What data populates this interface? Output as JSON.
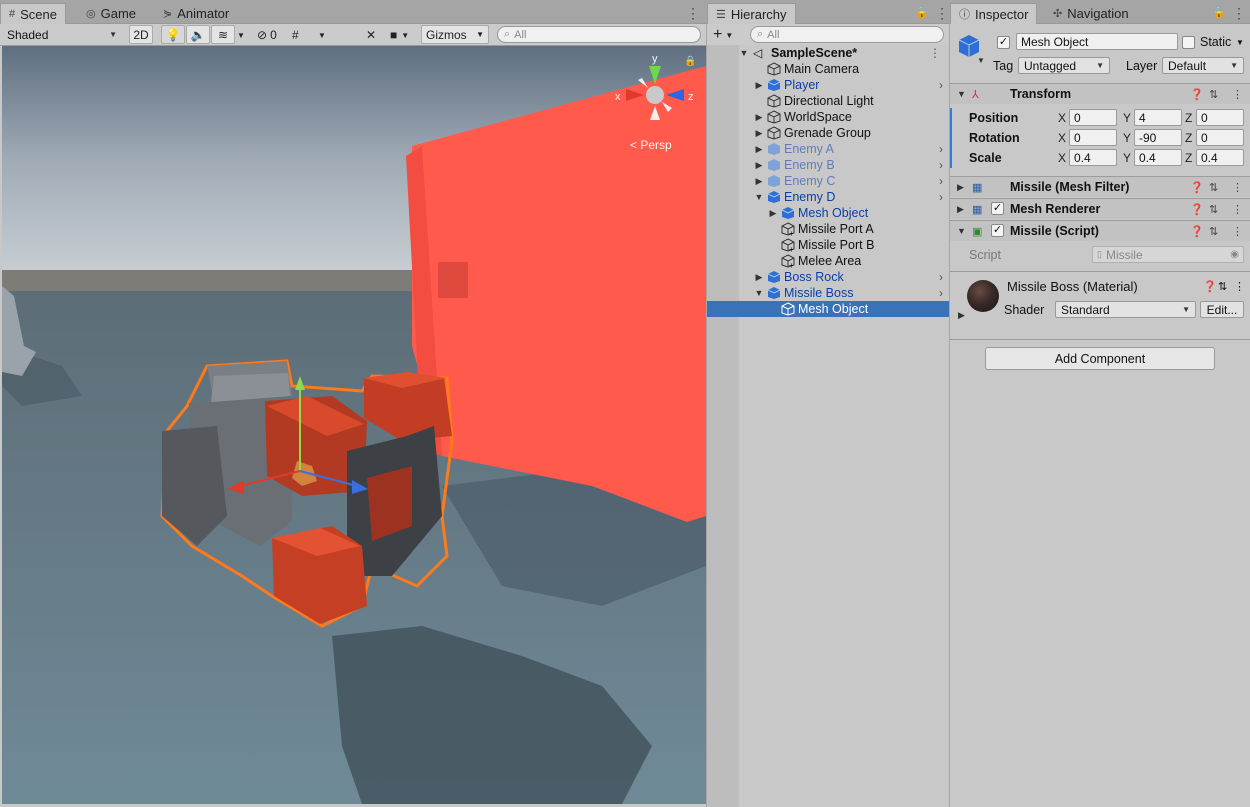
{
  "scene_panel": {
    "tabs": [
      {
        "label": "Scene",
        "icon": "hash-icon"
      },
      {
        "label": "Game",
        "icon": "gamepad-icon"
      },
      {
        "label": "Animator",
        "icon": "animator-icon"
      }
    ],
    "toolbar": {
      "shading_mode": "Shaded",
      "mode_2d": "2D",
      "hidden_count": "0",
      "gizmos": "Gizmos",
      "search_placeholder": "All"
    },
    "gizmo": {
      "y": "y",
      "x": "x",
      "z": "z",
      "projection": "Persp"
    }
  },
  "hierarchy": {
    "tab_label": "Hierarchy",
    "search_placeholder": "All",
    "scene_name": "SampleScene*",
    "rows": [
      {
        "label": "Main Camera"
      },
      {
        "label": "Player"
      },
      {
        "label": "Directional Light"
      },
      {
        "label": "WorldSpace"
      },
      {
        "label": "Grenade Group"
      },
      {
        "label": "Enemy A"
      },
      {
        "label": "Enemy B"
      },
      {
        "label": "Enemy C"
      },
      {
        "label": "Enemy D"
      },
      {
        "label": "Mesh Object"
      },
      {
        "label": "Missile Port A"
      },
      {
        "label": "Missile Port B"
      },
      {
        "label": "Melee Area"
      },
      {
        "label": "Boss Rock"
      },
      {
        "label": "Missile Boss"
      },
      {
        "label": "Mesh Object"
      }
    ]
  },
  "inspector": {
    "tabs": [
      {
        "label": "Inspector"
      },
      {
        "label": "Navigation"
      }
    ],
    "object": {
      "name": "Mesh Object",
      "static_label": "Static",
      "tag_label": "Tag",
      "tag_value": "Untagged",
      "layer_label": "Layer",
      "layer_value": "Default"
    },
    "transform": {
      "title": "Transform",
      "position_label": "Position",
      "rotation_label": "Rotation",
      "scale_label": "Scale",
      "axis_x": "X",
      "axis_y": "Y",
      "axis_z": "Z",
      "position": {
        "x": "0",
        "y": "4",
        "z": "0"
      },
      "rotation": {
        "x": "0",
        "y": "-90",
        "z": "0"
      },
      "scale": {
        "x": "0.4",
        "y": "0.4",
        "z": "0.4"
      }
    },
    "components": {
      "mesh_filter": "Missile (Mesh Filter)",
      "mesh_renderer": "Mesh Renderer",
      "script_title": "Missile (Script)",
      "script_label": "Script",
      "script_value": "Missile"
    },
    "material": {
      "name": "Missile Boss (Material)",
      "shader_label": "Shader",
      "shader_value": "Standard",
      "edit_label": "Edit..."
    },
    "add_component": "Add Component"
  }
}
